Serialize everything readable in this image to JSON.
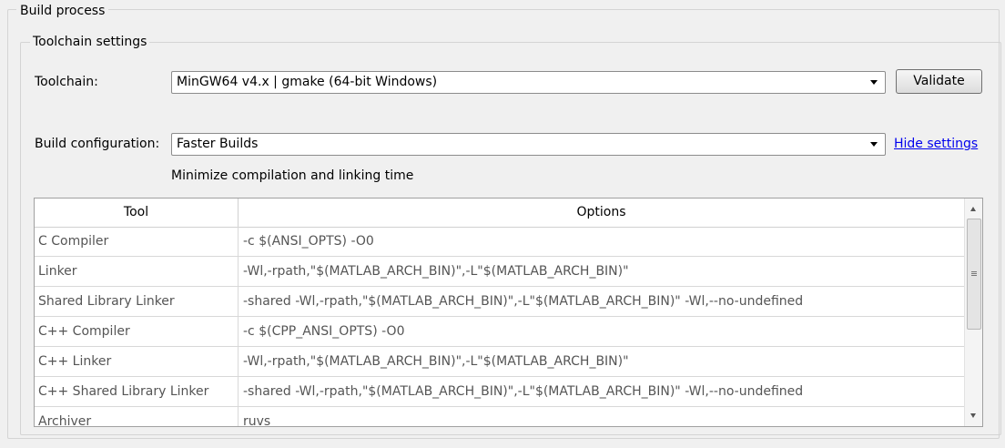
{
  "build_process": {
    "title": "Build process",
    "toolchain_settings": {
      "title": "Toolchain settings",
      "toolchain_label": "Toolchain:",
      "toolchain_value": "MinGW64 v4.x | gmake (64-bit Windows)",
      "validate_label": "Validate",
      "build_config_label": "Build configuration:",
      "build_config_value": "Faster Builds",
      "hide_settings_label": "Hide settings",
      "description": "Minimize compilation and linking time"
    },
    "table": {
      "headers": [
        "Tool",
        "Options"
      ],
      "rows": [
        {
          "tool": "C Compiler",
          "options": "-c $(ANSI_OPTS) -O0"
        },
        {
          "tool": "Linker",
          "options": "-Wl,-rpath,\"$(MATLAB_ARCH_BIN)\",-L\"$(MATLAB_ARCH_BIN)\""
        },
        {
          "tool": "Shared Library Linker",
          "options": "-shared -Wl,-rpath,\"$(MATLAB_ARCH_BIN)\",-L\"$(MATLAB_ARCH_BIN)\" -Wl,--no-undefined"
        },
        {
          "tool": "C++ Compiler",
          "options": "-c $(CPP_ANSI_OPTS) -O0"
        },
        {
          "tool": "C++ Linker",
          "options": "-Wl,-rpath,\"$(MATLAB_ARCH_BIN)\",-L\"$(MATLAB_ARCH_BIN)\""
        },
        {
          "tool": "C++ Shared Library Linker",
          "options": "-shared -Wl,-rpath,\"$(MATLAB_ARCH_BIN)\",-L\"$(MATLAB_ARCH_BIN)\" -Wl,--no-undefined"
        },
        {
          "tool": "Archiver",
          "options": "ruvs"
        }
      ]
    }
  },
  "colors": {
    "link": "#0000ee",
    "background": "#f0f0f0"
  }
}
